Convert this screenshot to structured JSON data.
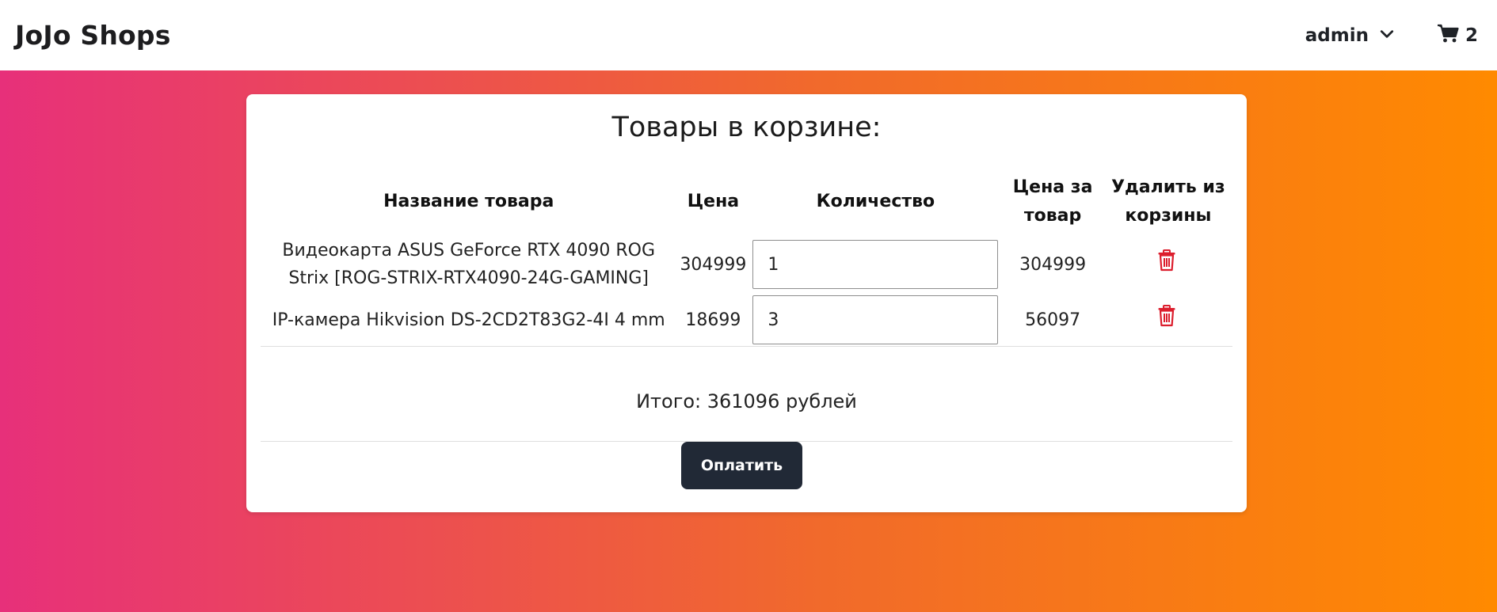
{
  "navbar": {
    "brand": "JoJo Shops",
    "user_label": "admin",
    "cart_count": "2"
  },
  "cart": {
    "title": "Товары в корзине:",
    "headers": {
      "name": "Название товара",
      "price": "Цена",
      "quantity": "Количество",
      "unit_total": "Цена за товар",
      "delete": "Удалить из корзины"
    },
    "items": [
      {
        "name": "Видеокарта ASUS GeForce RTX 4090 ROG Strix [ROG-STRIX-RTX4090-24G-GAMING]",
        "price": "304999",
        "quantity": "1",
        "unit_total": "304999"
      },
      {
        "name": "IP-камера Hikvision DS-2CD2T83G2-4I 4 mm",
        "price": "18699",
        "quantity": "3",
        "unit_total": "56097"
      }
    ],
    "total_label": "Итого: 361096 рублей",
    "pay_label": "Оплатить"
  },
  "icons": {
    "user_dropdown": "chevron-down-icon",
    "cart": "cart-icon",
    "delete": "trash-icon"
  },
  "colors": {
    "gradient_start": "#e7307a",
    "gradient_end": "#ff8a00",
    "pay_button": "#212936",
    "delete_icon": "#dc1e2d"
  }
}
